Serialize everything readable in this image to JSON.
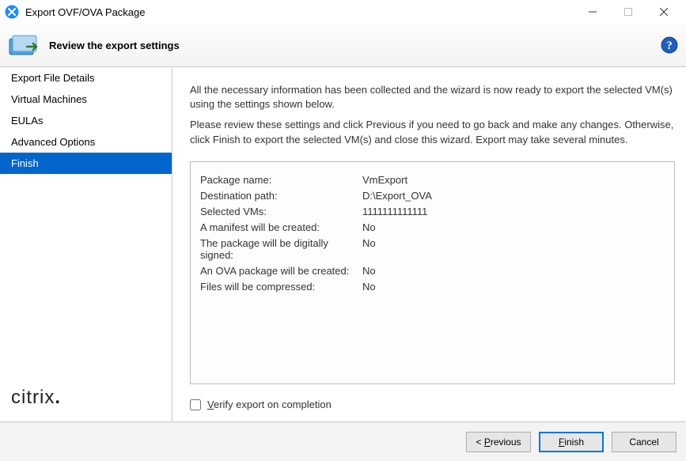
{
  "window": {
    "title": "Export OVF/OVA Package"
  },
  "header": {
    "title": "Review the export settings"
  },
  "sidebar": {
    "items": [
      {
        "label": "Export File Details"
      },
      {
        "label": "Virtual Machines"
      },
      {
        "label": "EULAs"
      },
      {
        "label": "Advanced Options"
      },
      {
        "label": "Finish"
      }
    ],
    "brand": "citrix"
  },
  "main": {
    "instr1": "All the necessary information has been collected and the wizard is now ready to export the selected VM(s) using the settings shown below.",
    "instr2": "Please review these settings and click Previous if you need to go back and make any changes. Otherwise, click Finish to export the selected VM(s) and close this wizard. Export may take several minutes.",
    "settings": [
      {
        "label": "Package name:",
        "value": "VmExport"
      },
      {
        "label": "Destination path:",
        "value": "D:\\Export_OVA"
      },
      {
        "label": "Selected VMs:",
        "value": "1111111111111"
      },
      {
        "label": "A manifest will be created:",
        "value": "No"
      },
      {
        "label": "The package will be digitally signed:",
        "value": "No"
      },
      {
        "label": "An OVA package will be created:",
        "value": "No"
      },
      {
        "label": "Files will be compressed:",
        "value": "No"
      }
    ],
    "verify_label_prefix": "",
    "verify_label_underline": "V",
    "verify_label_rest": "erify export on completion"
  },
  "footer": {
    "previous_prefix": "< ",
    "previous_underline": "P",
    "previous_rest": "revious",
    "finish_underline": "F",
    "finish_rest": "inish",
    "cancel_label": "Cancel"
  }
}
